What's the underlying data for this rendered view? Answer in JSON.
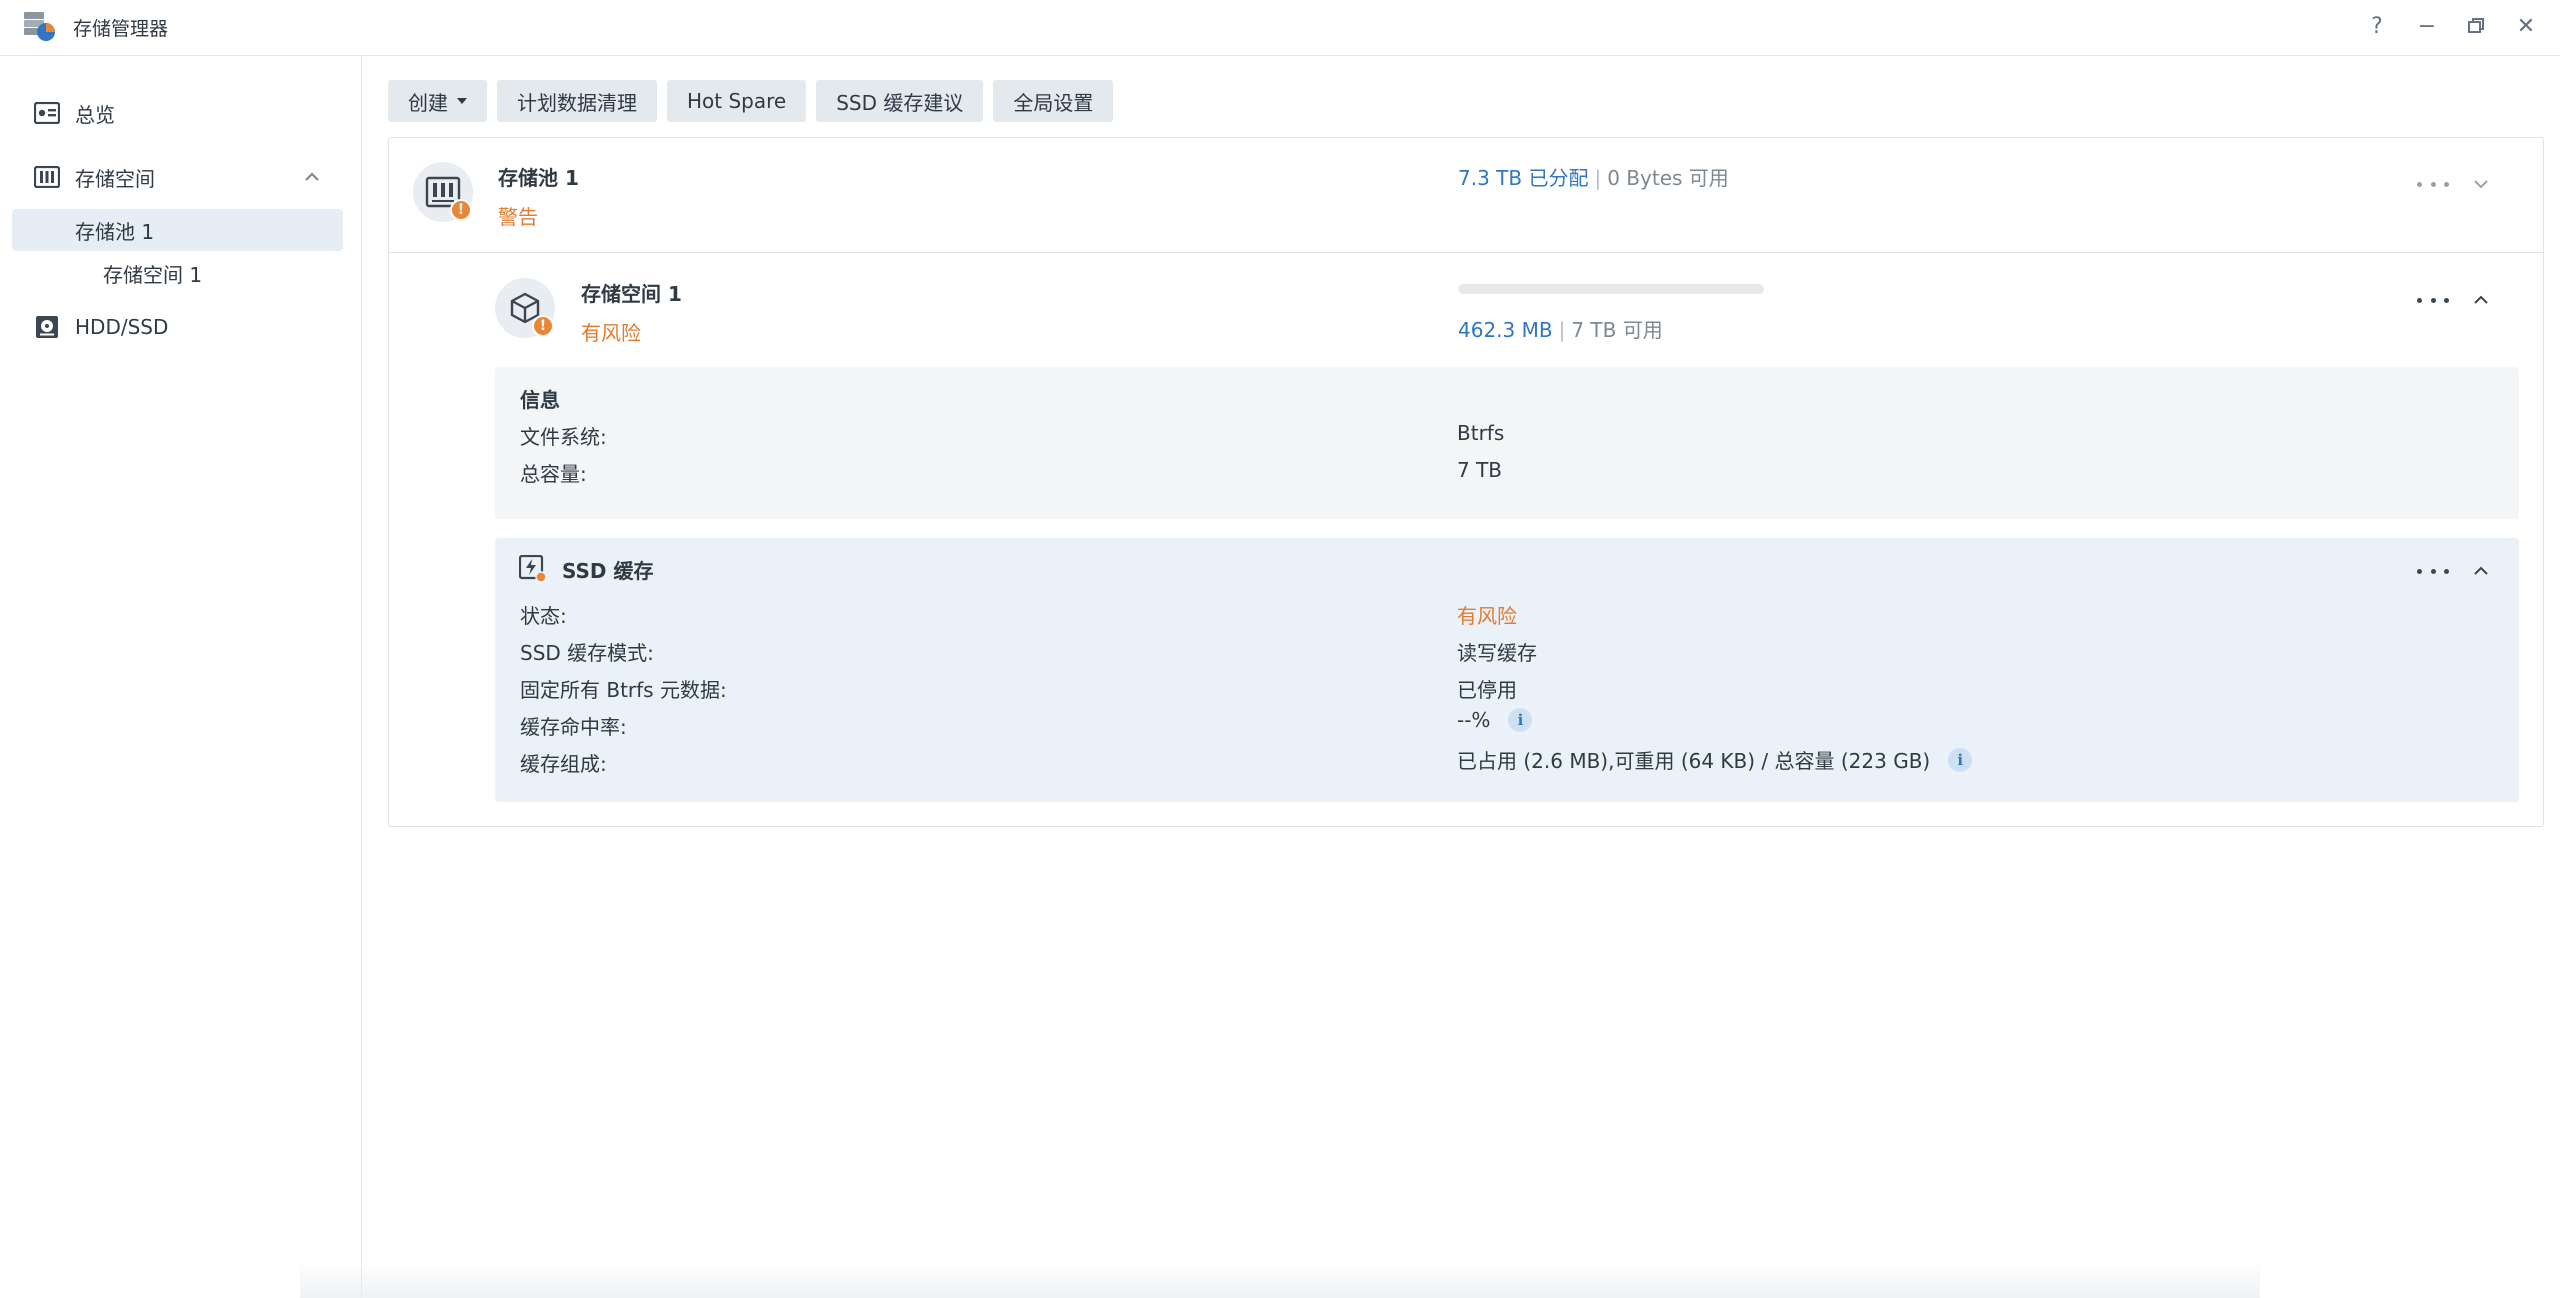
{
  "window": {
    "title": "存储管理器",
    "controls": {
      "help": "?",
      "minimize": "−",
      "restore": "❐",
      "close": "✕"
    }
  },
  "sidebar": {
    "items": [
      {
        "label": "总览",
        "icon": "overview-icon"
      },
      {
        "label": "存储空间",
        "icon": "storage-icon",
        "expanded": true
      },
      {
        "label": "存储池 1",
        "selected": true
      },
      {
        "label": "存储空间 1"
      },
      {
        "label": "HDD/SSD",
        "icon": "disk-icon"
      }
    ]
  },
  "toolbar": {
    "create": "创建",
    "scrub": "计划数据清理",
    "hotspare": "Hot Spare",
    "ssd_advisor": "SSD 缓存建议",
    "global_settings": "全局设置"
  },
  "pool": {
    "name": "存储池 1",
    "status": "警告",
    "allocated": "7.3 TB 已分配",
    "separator": "|",
    "available": "0 Bytes 可用"
  },
  "volume": {
    "name": "存储空间 1",
    "status": "有风险",
    "used": "462.3 MB",
    "separator": "|",
    "available": "7 TB 可用",
    "usage_fraction": 0.0
  },
  "info": {
    "title": "信息",
    "rows": [
      {
        "label": "文件系统:",
        "value": "Btrfs"
      },
      {
        "label": "总容量:",
        "value": "7 TB"
      }
    ]
  },
  "ssd_cache": {
    "title": "SSD 缓存",
    "rows": [
      {
        "label": "状态:",
        "value": "有风险"
      },
      {
        "label": "SSD 缓存模式:",
        "value": "读写缓存"
      },
      {
        "label": "固定所有 Btrfs 元数据:",
        "value": "已停用"
      },
      {
        "label": "缓存命中率:",
        "value": "--%"
      },
      {
        "label": "缓存组成:",
        "value": "已占用 (2.6 MB),可重用 (64 KB) / 总容量 (223 GB)"
      }
    ]
  },
  "colors": {
    "accent_blue": "#2f76c3",
    "warning_orange": "#e07b2f",
    "selected_bg": "#e6edf5"
  }
}
